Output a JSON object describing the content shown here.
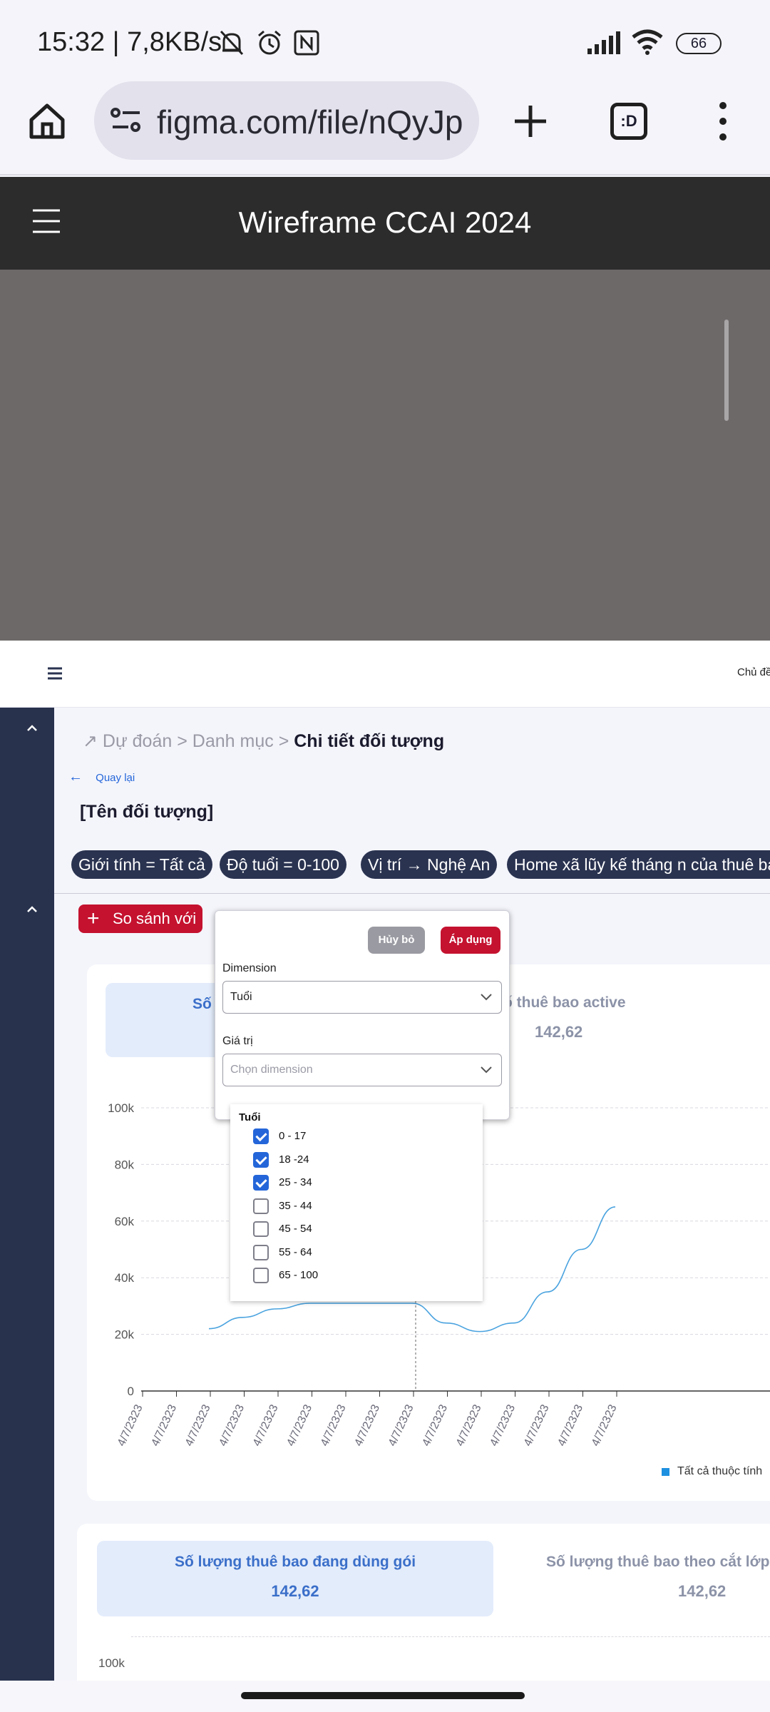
{
  "status_bar": {
    "time": "15:32 | 7,8KB/s",
    "battery": "66"
  },
  "browser": {
    "url": "figma.com/file/nQyJp",
    "tabs_icon_label": ":D"
  },
  "figma": {
    "title": "Wireframe CCAI 2024"
  },
  "app": {
    "topbar_right_text": "Chủ đề",
    "breadcrumb": {
      "part1": "Dự đoán",
      "sep1": ">",
      "part2": "Danh mục",
      "sep2": ">",
      "current": "Chi tiết đối tượng"
    },
    "back_label": "Quay lại",
    "object_name": "[Tên đối tượng]",
    "filters": [
      "Giới tính = Tất cả",
      "Độ tuổi = 0-100",
      "Vị trí → Nghệ An",
      "Home xã lũy kế tháng n của thuê bao"
    ],
    "compare_button": "So sánh với",
    "card1": {
      "metric_left_label": "Số",
      "metric_right_label": "ố thuê bao active",
      "metric_right_value": "142,62"
    },
    "legend_label": "Tất cả thuộc tính",
    "card2": {
      "metric_left_label": "Số lượng thuê bao đang dùng gói",
      "metric_left_value": "142,62",
      "metric_right_label": "Số lượng thuê bao theo cắt lớp t",
      "metric_right_value": "142,62",
      "first_y_label": "100k"
    }
  },
  "popover": {
    "cancel_label": "Hủy bỏ",
    "apply_label": "Áp dụng",
    "dimension_label": "Dimension",
    "dimension_value": "Tuổi",
    "value_label": "Giá trị",
    "value_placeholder": "Chọn dimension",
    "list_header": "Tuổi",
    "options": [
      {
        "label": "0 - 17",
        "checked": true
      },
      {
        "label": "18 -24",
        "checked": true
      },
      {
        "label": "25 - 34",
        "checked": true
      },
      {
        "label": "35 - 44",
        "checked": false
      },
      {
        "label": "45 - 54",
        "checked": false
      },
      {
        "label": "55 - 64",
        "checked": false
      },
      {
        "label": "65 - 100",
        "checked": false
      }
    ]
  },
  "chart_data": {
    "type": "line",
    "x": [
      "4/7/2323",
      "4/7/2323",
      "4/7/2323",
      "4/7/2323",
      "4/7/2323",
      "4/7/2323",
      "4/7/2323",
      "4/7/2323",
      "4/7/2323",
      "4/7/2323",
      "4/7/2323",
      "4/7/2323",
      "4/7/2323",
      "4/7/2323",
      "4/7/2323"
    ],
    "y_ticks": [
      "0",
      "20k",
      "40k",
      "60k",
      "80k",
      "100k"
    ],
    "ylim": [
      0,
      100000
    ],
    "series": [
      {
        "name": "Tất cả thuộc tính",
        "color": "#4aa3df",
        "values": [
          null,
          null,
          22000,
          26000,
          29000,
          31000,
          null,
          null,
          31000,
          24000,
          21000,
          24000,
          35000,
          50000,
          65000
        ]
      }
    ],
    "grid": true,
    "legend": "bottom-right"
  },
  "colors": {
    "accent_red": "#c4122f",
    "navy": "#28324d",
    "checkbox_blue": "#2466d9"
  }
}
